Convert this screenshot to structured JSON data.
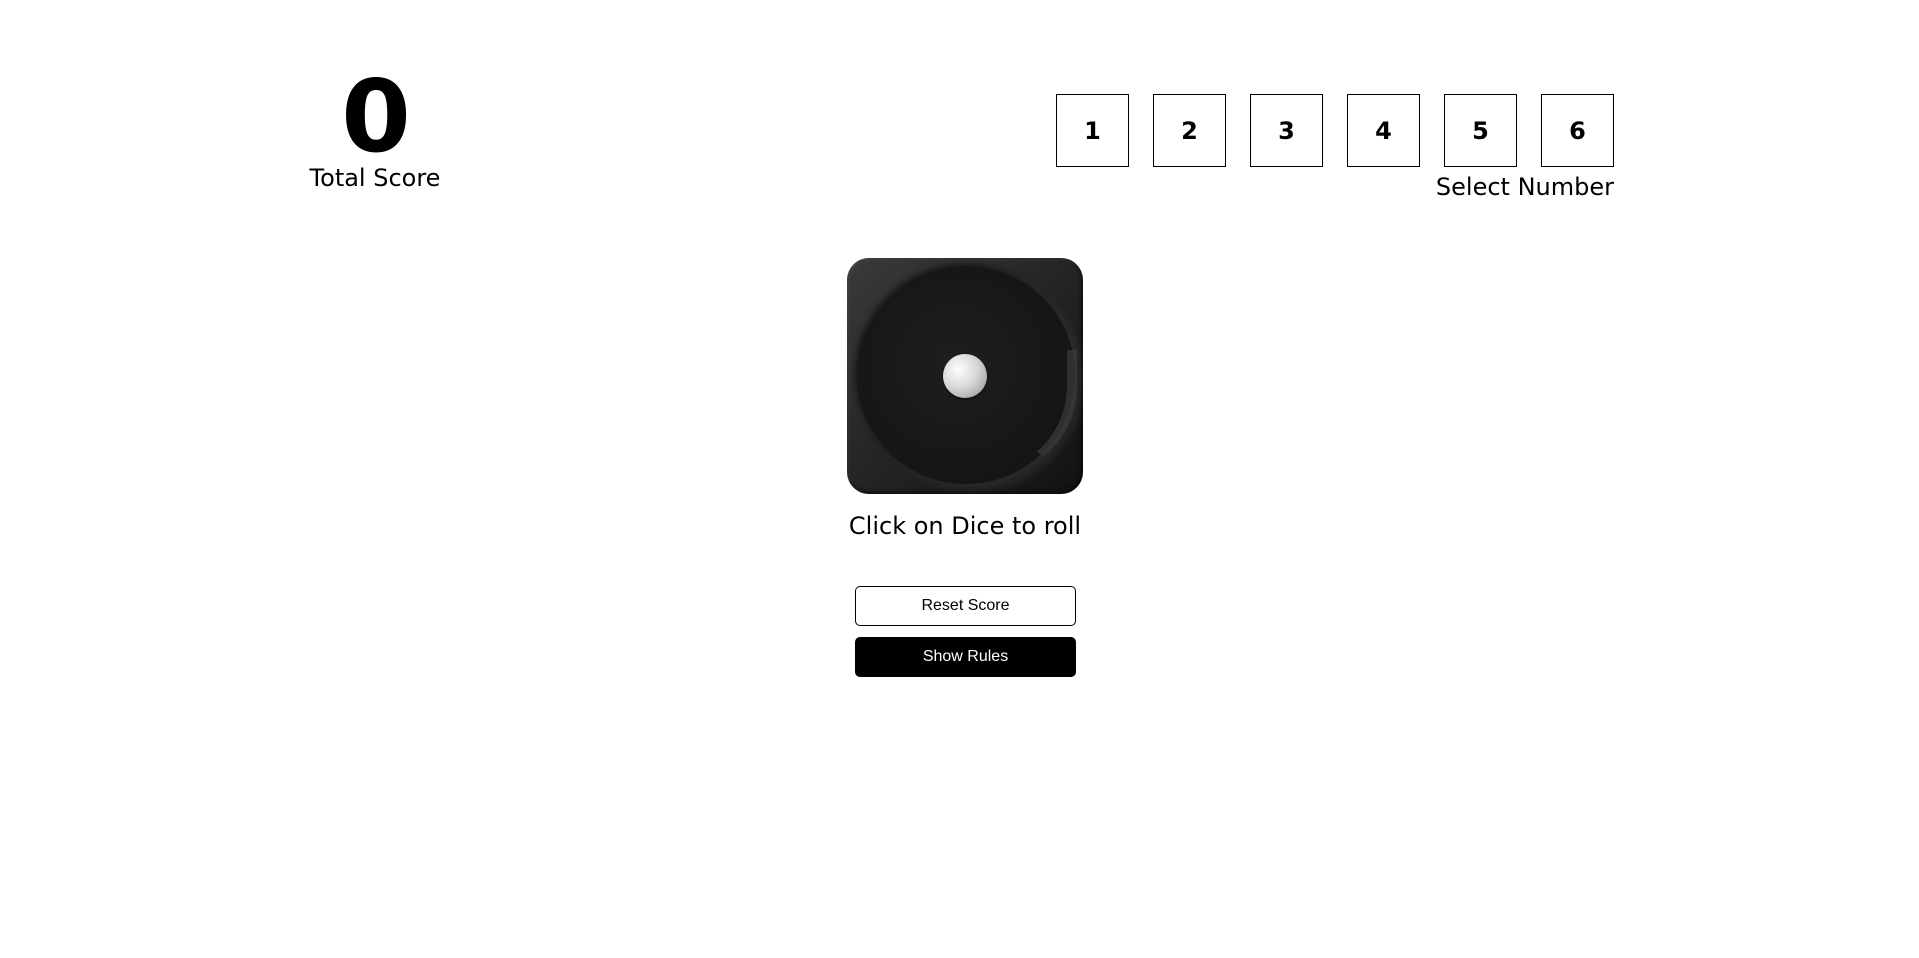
{
  "score": {
    "value": "0",
    "label": "Total Score"
  },
  "selector": {
    "numbers": [
      "1",
      "2",
      "3",
      "4",
      "5",
      "6"
    ],
    "label": "Select Number"
  },
  "dice": {
    "face_value": 1,
    "caption": "Click on Dice to roll"
  },
  "buttons": {
    "reset_label": "Reset Score",
    "rules_label": "Show Rules"
  },
  "colors": {
    "text": "#000000",
    "background": "#ffffff",
    "dice_body": "#262626",
    "pip": "#d8d8d8",
    "solid_button": "#000000"
  },
  "icons": {
    "dice": "dice-face-one-icon"
  }
}
